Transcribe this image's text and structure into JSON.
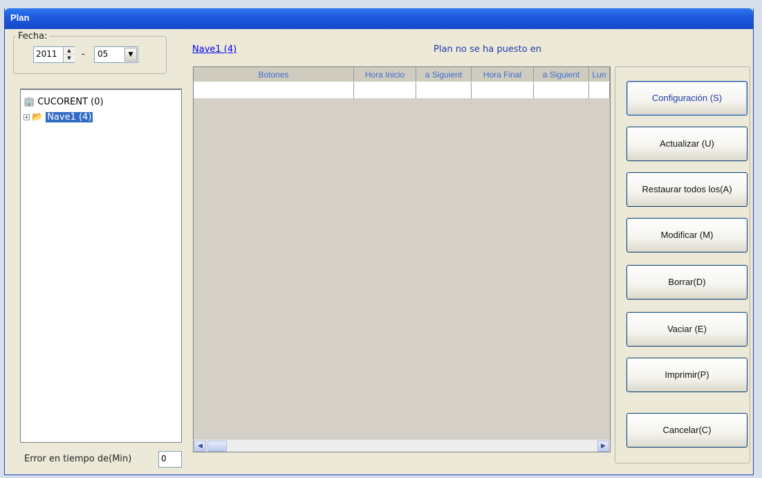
{
  "window": {
    "title": "Plan"
  },
  "fecha": {
    "label": "Fecha:",
    "year": "2011",
    "separator": "-",
    "month": "05"
  },
  "tree": {
    "root": {
      "label": "CUCORENT (0)",
      "icon": "building-icon"
    },
    "child": {
      "label": "Nave1 (4)",
      "icon": "open-folder-icon",
      "expander": "+"
    }
  },
  "error": {
    "label": "Error en tiempo de(Min)",
    "value": "0"
  },
  "header": {
    "link": "Nave1 (4)",
    "status": "Plan no se ha puesto en"
  },
  "grid": {
    "columns": [
      "Botones",
      "Hora Inicio",
      "a Siguient",
      "Hora Final",
      "a Siguient",
      "Lun"
    ]
  },
  "buttons": [
    {
      "id": "configuracion",
      "label": "Configuración (S)"
    },
    {
      "id": "actualizar",
      "label": "Actualizar (U)"
    },
    {
      "id": "restaurar",
      "label": "Restaurar todos los(A)"
    },
    {
      "id": "modificar",
      "label": "Modificar (M)"
    },
    {
      "id": "borrar",
      "label": "Borrar(D)"
    },
    {
      "id": "vaciar",
      "label": "Vaciar (E)"
    },
    {
      "id": "imprimir",
      "label": "Imprimir(P)"
    },
    {
      "id": "cancelar",
      "label": "Cancelar(C)"
    }
  ],
  "colors": {
    "titlebar": "#1e5be0",
    "selection": "#316ac5",
    "link": "#0000ee",
    "header_text": "#3a6ed0"
  }
}
